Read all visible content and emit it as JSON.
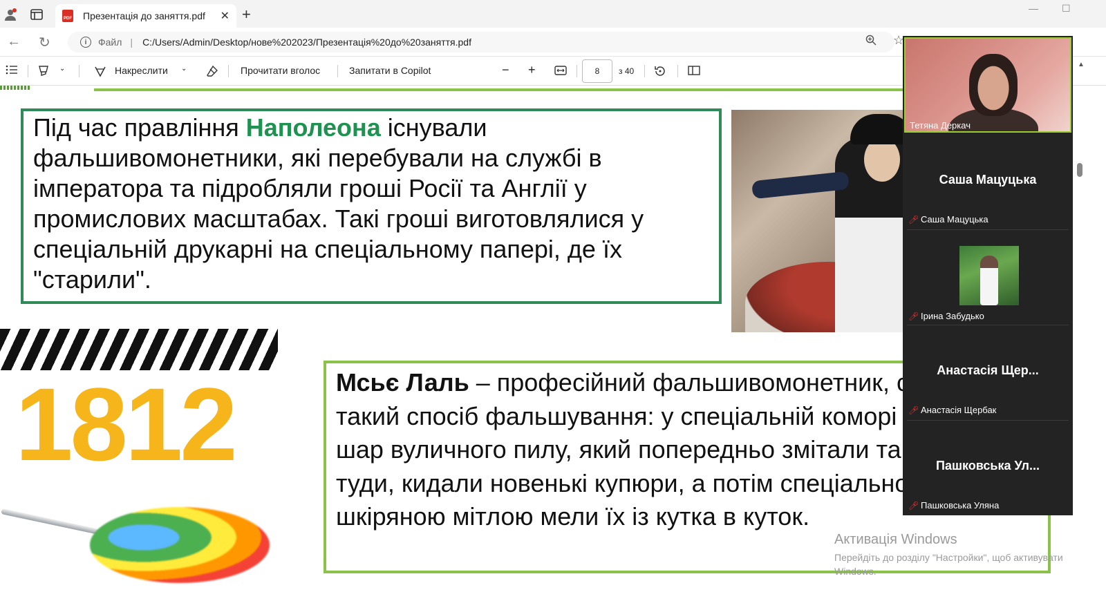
{
  "browser": {
    "tab_title": "Презентація до заняття.pdf",
    "pdf_badge": "PDF",
    "url_prefix": "Файл",
    "url_separator": "|",
    "url": "C:/Users/Admin/Desktop/нове%202023/Презентація%20до%20заняття.pdf"
  },
  "pdf_toolbar": {
    "draw_label": "Накреслити",
    "read_aloud_label": "Прочитати вголос",
    "copilot_label": "Запитати в Copilot",
    "page_current": "8",
    "page_total": "з 40"
  },
  "slide": {
    "box1_part1": "Під час правління ",
    "box1_highlight": "Наполеона",
    "box1_part2": " існували фальшивомонетники, які перебували на службі в імператора та підробляли гроші Росії та Англії у промислових масштабах. Такі гроші виготовлялися у спеціальній друкарні на спеціальному папері, де їх \"старили\".",
    "year": "1812",
    "box2_bold": "Мсьє Лаль",
    "box2_text": " – професійний фальшивомонетник, створив такий спосіб фальшування: у спеціальній коморі на товстий шар вуличного пилу, який попередньо змітали та приносили туди, кидали новенькі купюри, а потім спеціальною шкіряною мітлою мели їх із кутка в куток."
  },
  "watermark": {
    "line1": "Активація Windows",
    "line2": "Перейдіть до розділу \"Настройки\", щоб активувати",
    "line3": "Windows."
  },
  "participants": [
    {
      "name": "Тетяна Деркач"
    },
    {
      "display": "Саша Мацуцька",
      "name": "Саша Мацуцька"
    },
    {
      "name": "Ірина Забудько"
    },
    {
      "display": "Анастасія Щер...",
      "name": "Анастасія Щербак"
    },
    {
      "display": "Пашковська Ул...",
      "name": "Пашковська Уляна"
    }
  ],
  "colors": {
    "accent_green": "#2e8b57",
    "light_green": "#8bc34a",
    "year_yellow": "#f7b51c",
    "mute_red": "#e53935"
  }
}
